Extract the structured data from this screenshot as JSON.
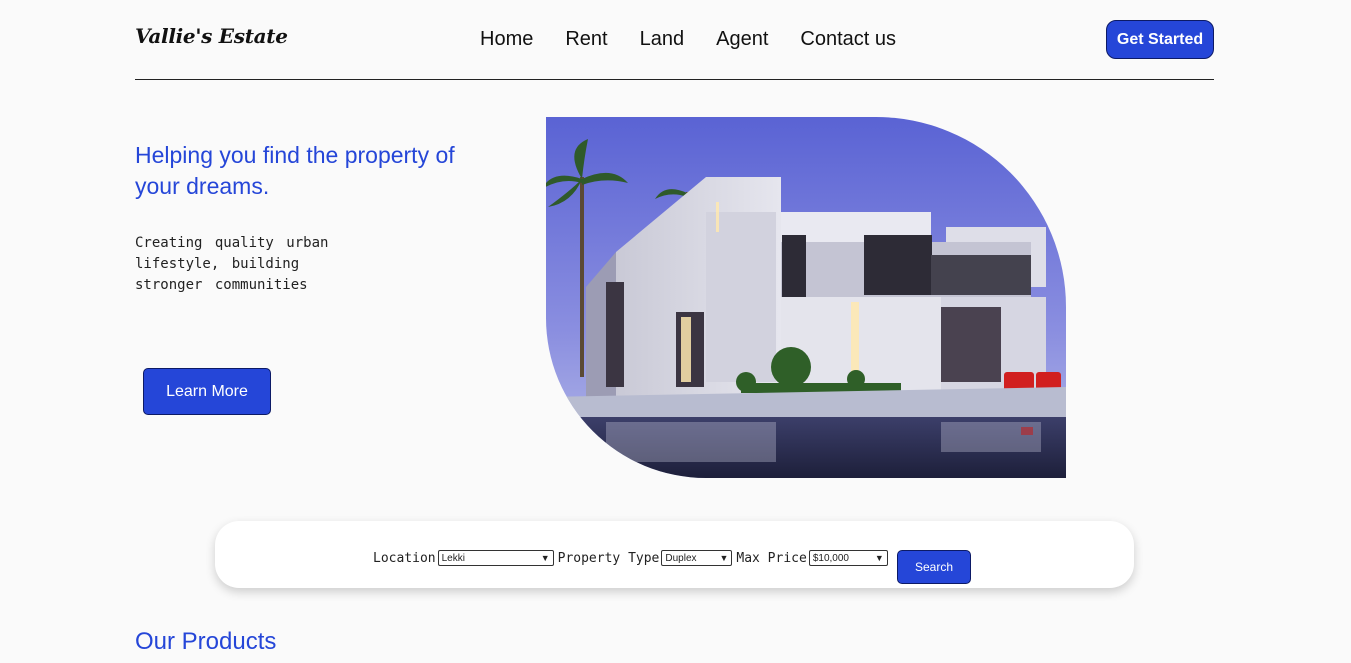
{
  "header": {
    "logo": "Vallie's Estate",
    "menu": [
      "Home",
      "Rent",
      "Land",
      "Agent",
      "Contact us"
    ],
    "cta_label": "Get Started"
  },
  "hero": {
    "title": "Helping you find the property of your dreams.",
    "subtitle_line1": "Creating quality urban lifestyle, building",
    "subtitle_line2": "stronger communities",
    "button_label": "Learn More",
    "image_alt": "modern house"
  },
  "search": {
    "location_label": "Location",
    "location_value": "Lekki",
    "type_label": "Property Type",
    "type_value": "Duplex",
    "price_label": "Max Price",
    "price_value": "$10,000",
    "button_label": "Search"
  },
  "products": {
    "title": "Our Products"
  },
  "colors": {
    "accent": "#2546d8",
    "background": "#fafafa"
  }
}
